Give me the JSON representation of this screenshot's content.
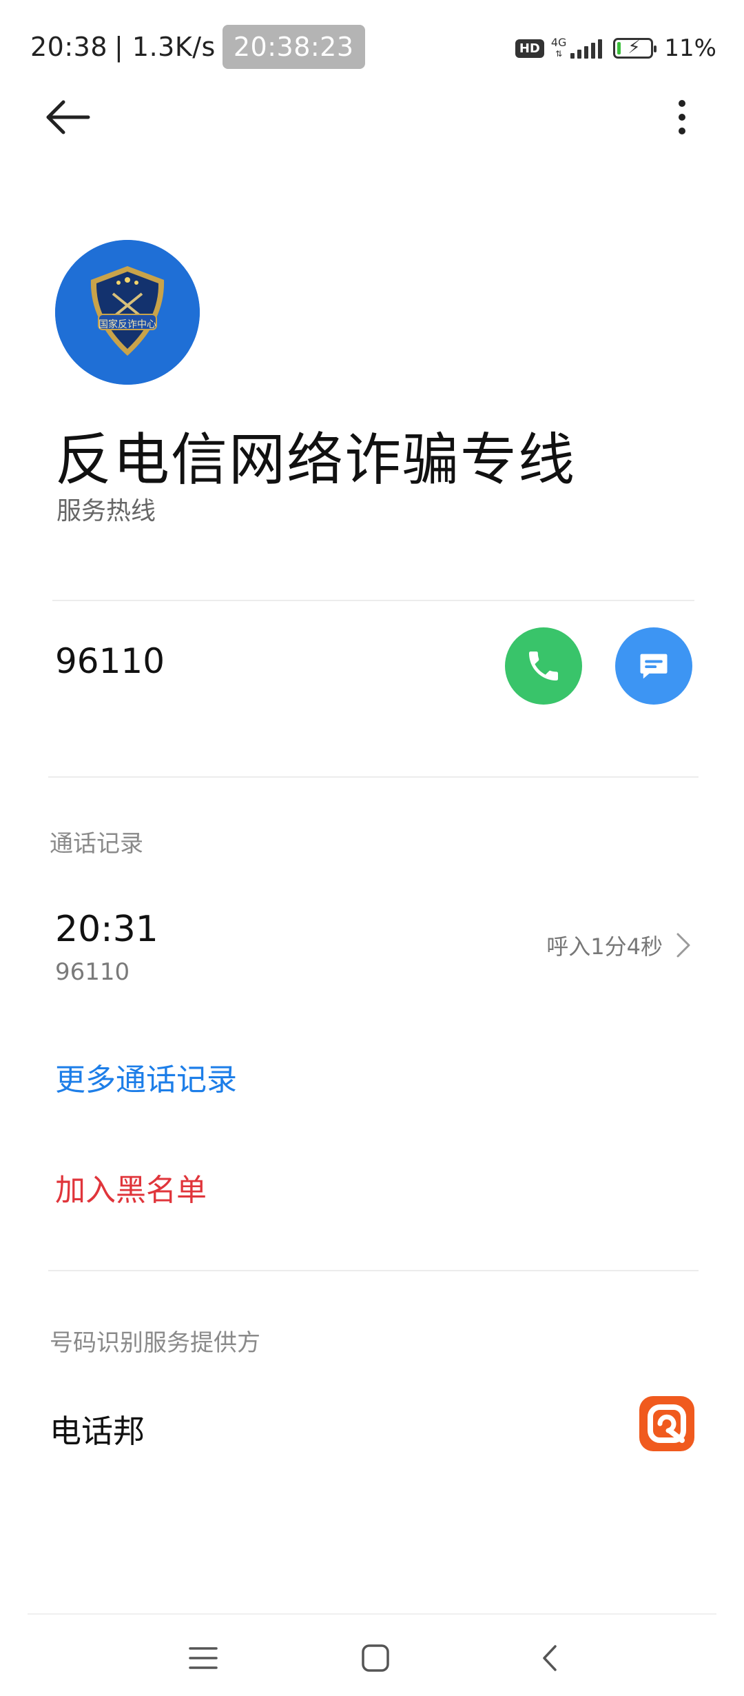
{
  "status_bar": {
    "time": "20:38",
    "net_speed": "| 1.3K/s",
    "clock_overlay": "20:38:23",
    "hd_label": "HD",
    "network_type": "4G",
    "battery_percent": "11%",
    "battery_level": 0.11
  },
  "header": {
    "back_icon": "arrow-left-icon",
    "more_icon": "more-vertical-icon"
  },
  "contact": {
    "avatar_text": "国家反诈中心",
    "name": "反电信网络诈骗专线",
    "subtitle": "服务热线",
    "phone": "96110",
    "call_icon": "phone-icon",
    "message_icon": "message-icon"
  },
  "call_log": {
    "section_title": "通话记录",
    "entries": [
      {
        "time": "20:31",
        "number": "96110",
        "detail": "呼入1分4秒"
      }
    ],
    "more_link": "更多通话记录"
  },
  "actions": {
    "block_label": "加入黑名单"
  },
  "provider": {
    "section_title": "号码识别服务提供方",
    "name": "电话邦",
    "logo_icon": "dianhuabang-logo-icon"
  },
  "nav_bar": {
    "menu_icon": "menu-icon",
    "home_icon": "home-square-icon",
    "back_icon": "chevron-left-icon"
  },
  "colors": {
    "call_green": "#39c46a",
    "message_blue": "#3d95f3",
    "link_blue": "#1d7ee8",
    "danger_red": "#e0353b",
    "avatar_blue": "#1f6fd6",
    "provider_orange": "#f05a1e"
  }
}
